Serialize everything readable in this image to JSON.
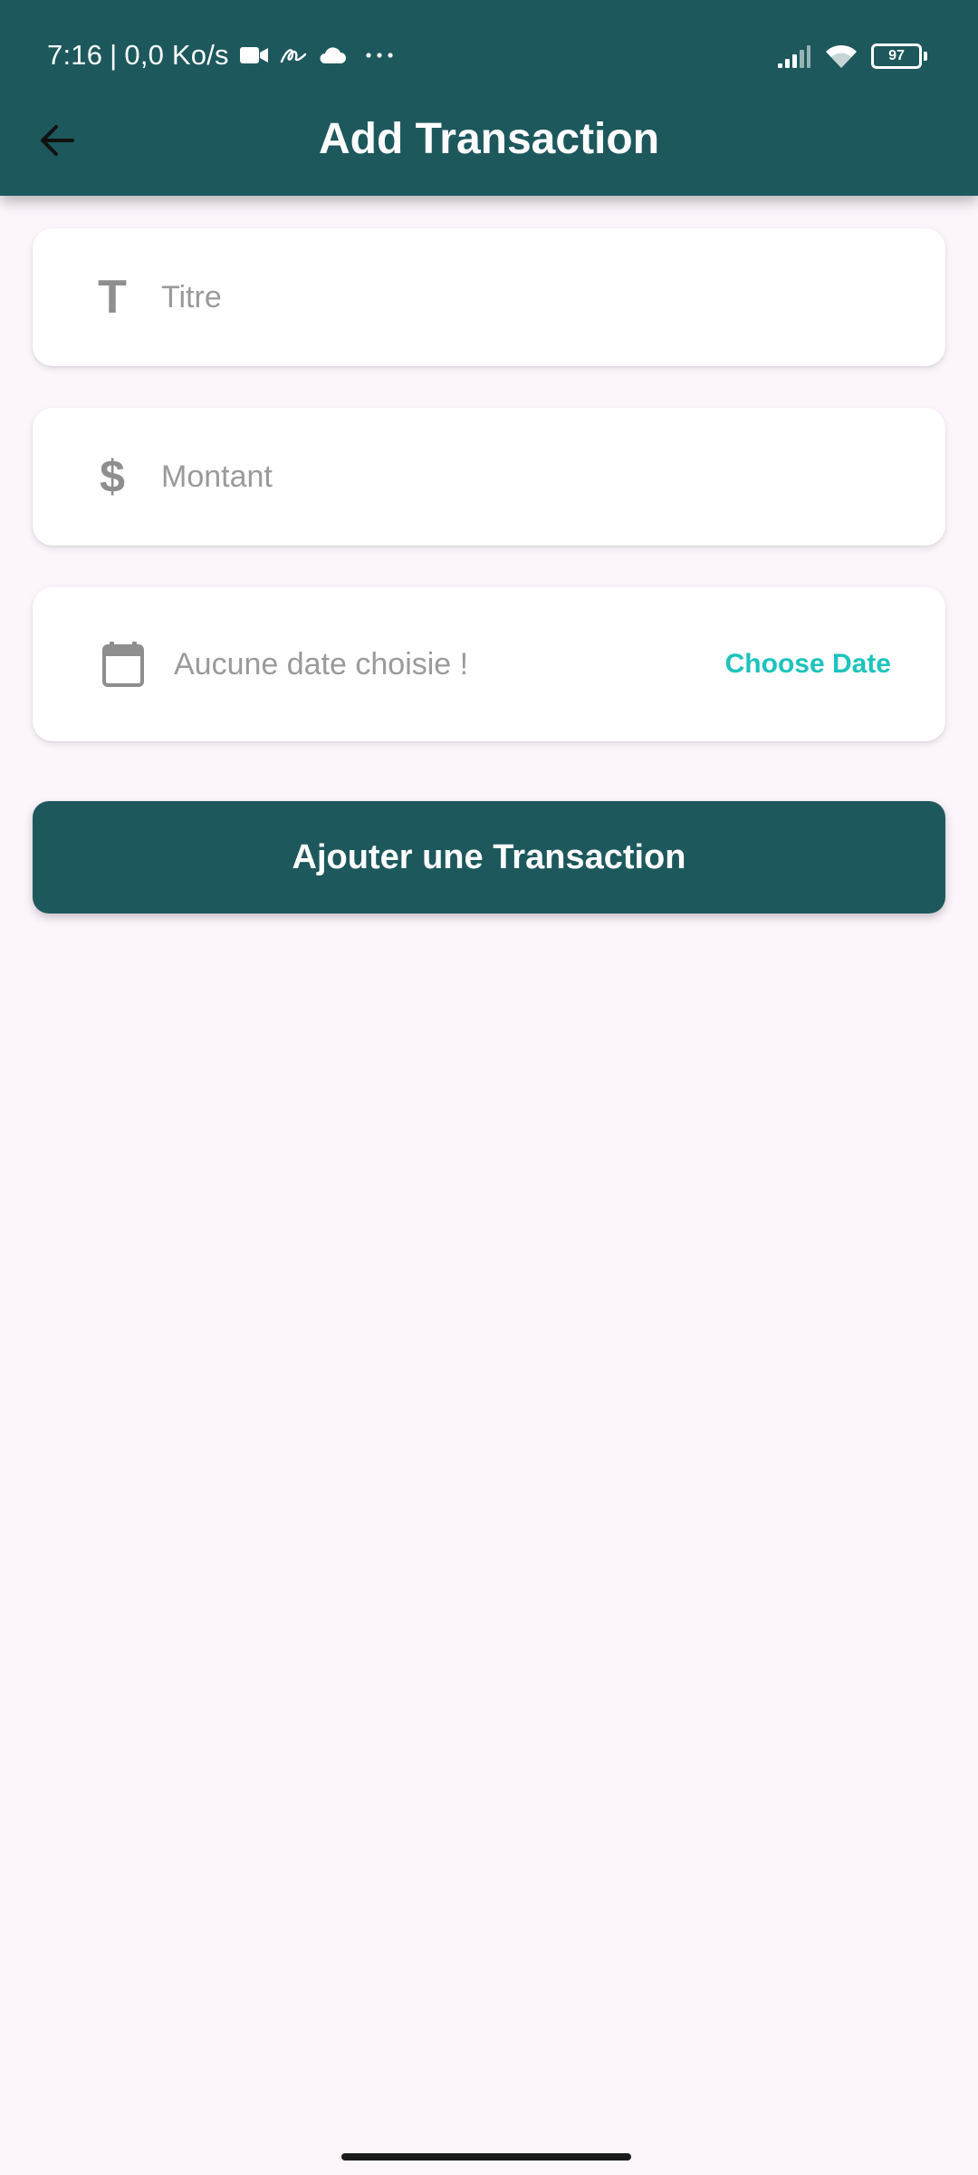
{
  "status_bar": {
    "time": "7:16",
    "separator": "|",
    "network_speed": "0,0 Ko/s",
    "icons": [
      "video-camera-icon",
      "signature-icon",
      "cloud-icon",
      "more-dots-icon",
      "cellular-signal-icon",
      "wifi-icon",
      "battery-icon"
    ],
    "battery_level": "97"
  },
  "header": {
    "back_icon": "arrow-left-icon",
    "title": "Add Transaction"
  },
  "form": {
    "title_field": {
      "icon": "text-t-icon",
      "icon_glyph": "T",
      "placeholder": "Titre",
      "value": ""
    },
    "amount_field": {
      "icon": "dollar-icon",
      "icon_glyph": "$",
      "placeholder": "Montant",
      "value": ""
    },
    "date_field": {
      "icon": "calendar-icon",
      "placeholder": "Aucune date choisie !",
      "choose_label": "Choose Date"
    },
    "submit_label": "Ajouter une Transaction"
  },
  "colors": {
    "primary": "#1D585C",
    "accent": "#1CC3BB",
    "background": "#FCF5FC",
    "card": "#FFFFFF",
    "placeholder": "#9A9A9A",
    "icon_gray": "#8E8E8E"
  }
}
